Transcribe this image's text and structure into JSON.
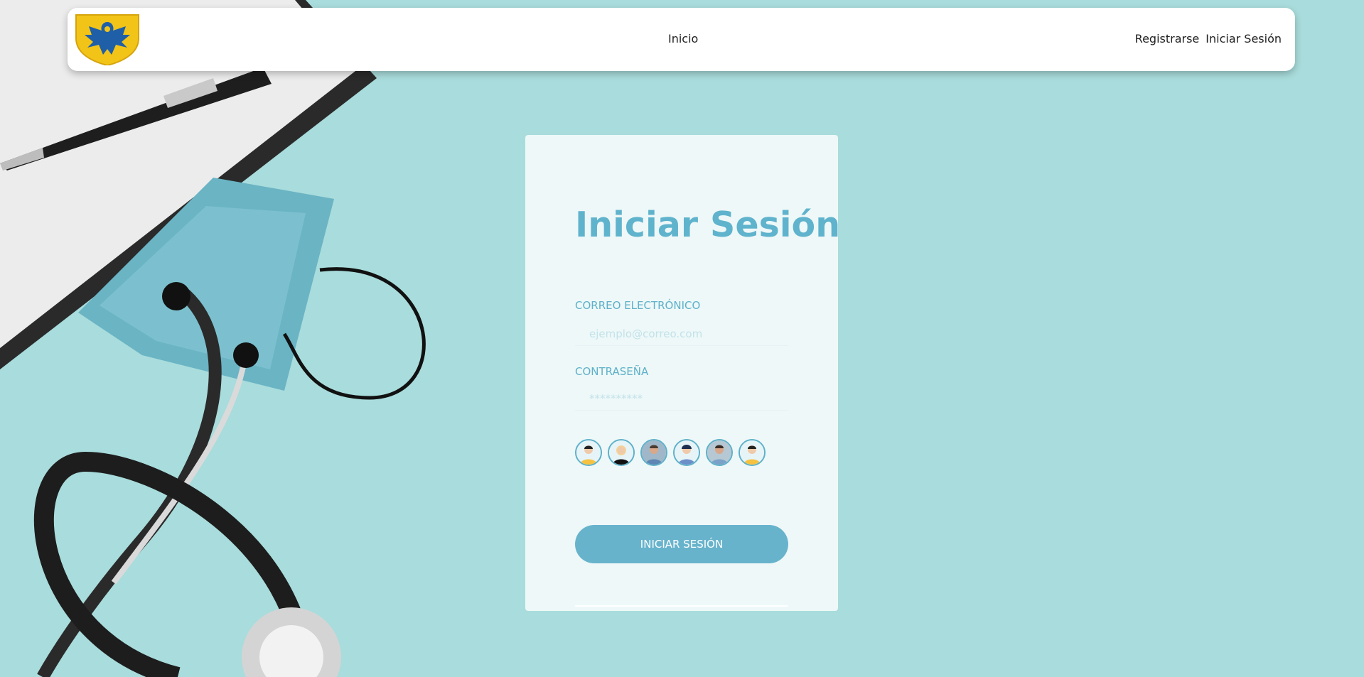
{
  "nav": {
    "home": "Inicio",
    "register": "Registrarse",
    "login": "Iniciar Sesión"
  },
  "login_card": {
    "title": "Iniciar Sesión",
    "email_label": "CORREO ELECTRÓNICO",
    "email_placeholder": "ejemplo@correo.com",
    "password_label": "CONTRASEÑA",
    "password_placeholder": "**********",
    "submit_label": "INICIAR SESIÓN",
    "avatars": [
      {
        "icon": "avatar-icon"
      },
      {
        "icon": "avatar-icon"
      },
      {
        "icon": "avatar-icon"
      },
      {
        "icon": "avatar-icon"
      },
      {
        "icon": "avatar-icon"
      },
      {
        "icon": "avatar-icon"
      }
    ]
  },
  "colors": {
    "background": "#a8dcdc",
    "accent": "#5fb3cc",
    "button": "#68b3cc",
    "logo_shield": "#f2c418",
    "logo_eagle": "#1f5fa8"
  }
}
